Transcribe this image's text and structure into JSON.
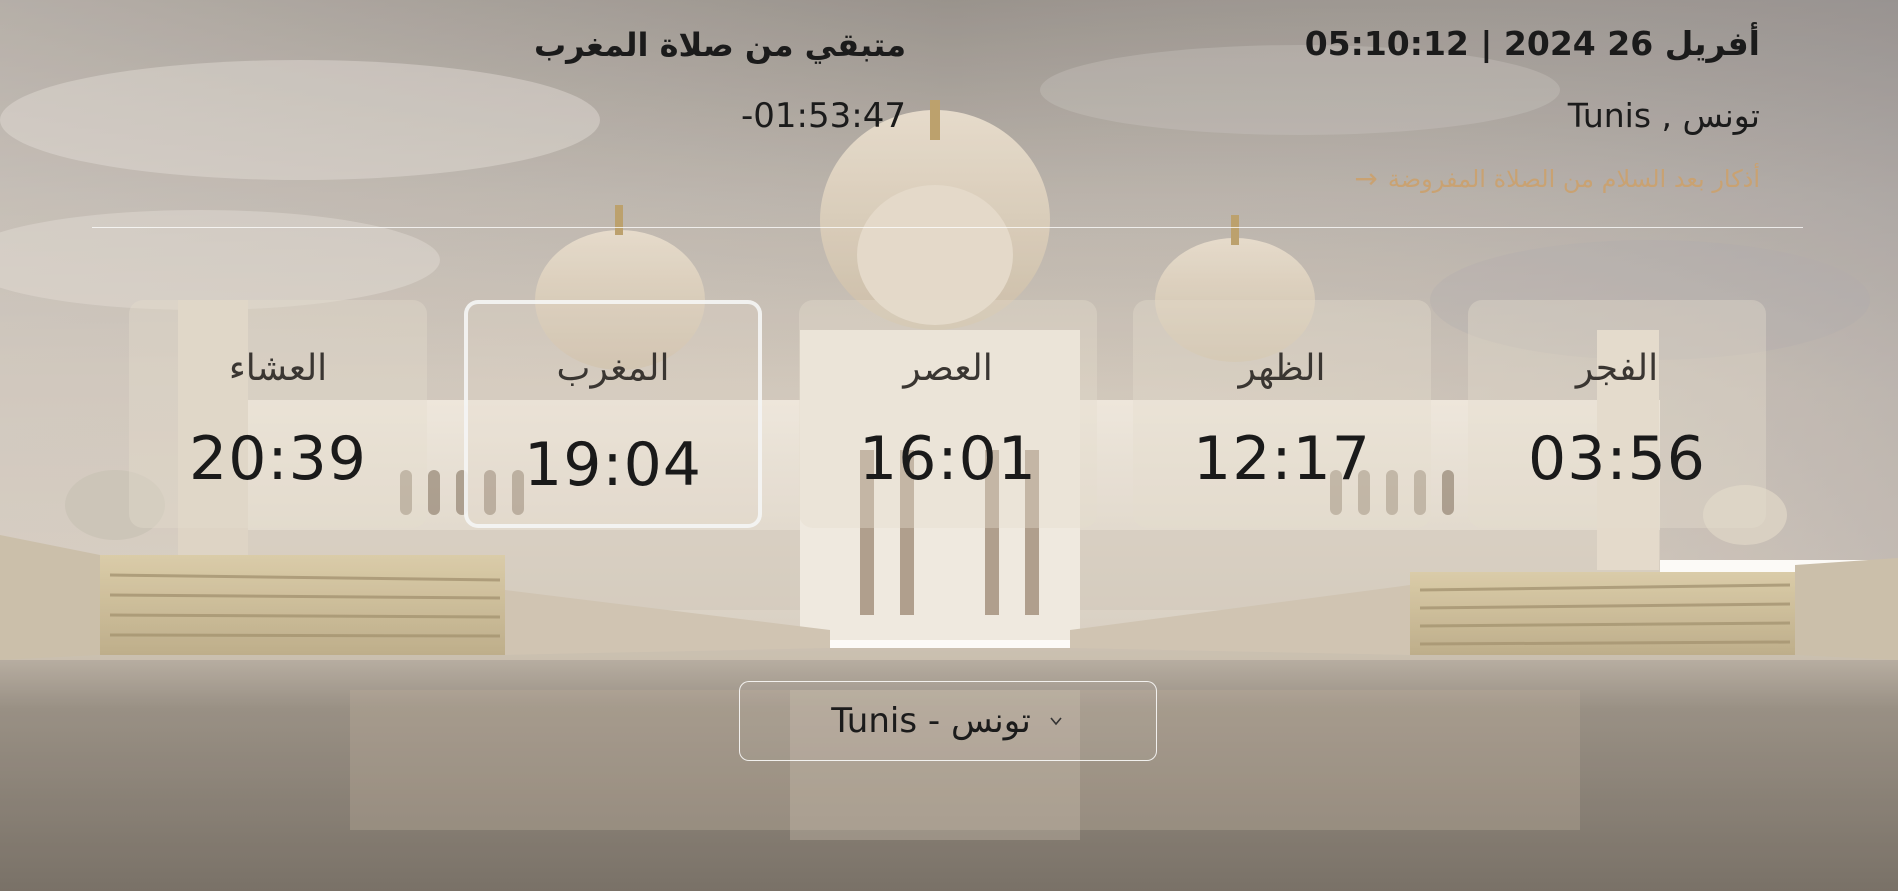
{
  "header": {
    "date_time": "أفريل 26 2024 | 05:10:12",
    "location": "تونس , Tunis",
    "adhkar_link": "أذكار بعد السلام من الصلاة المفروضة",
    "remaining_label": "متبقي من صلاة المغرب",
    "remaining_time": "-01:53:47"
  },
  "prayers": [
    {
      "name": "الفجر",
      "time": "03:56",
      "active": false
    },
    {
      "name": "الظهر",
      "time": "12:17",
      "active": false
    },
    {
      "name": "العصر",
      "time": "16:01",
      "active": false
    },
    {
      "name": "المغرب",
      "time": "19:04",
      "active": true
    },
    {
      "name": "العشاء",
      "time": "20:39",
      "active": false
    }
  ],
  "city_select": {
    "selected": "تونس - Tunis"
  },
  "icons": {
    "link_arrow": "arrow-right-icon",
    "select_chevron": "chevron-down-icon"
  },
  "colors": {
    "accent_link": "#c9a272",
    "text": "#1b1b1b",
    "active_border": "#f5f5f5"
  }
}
